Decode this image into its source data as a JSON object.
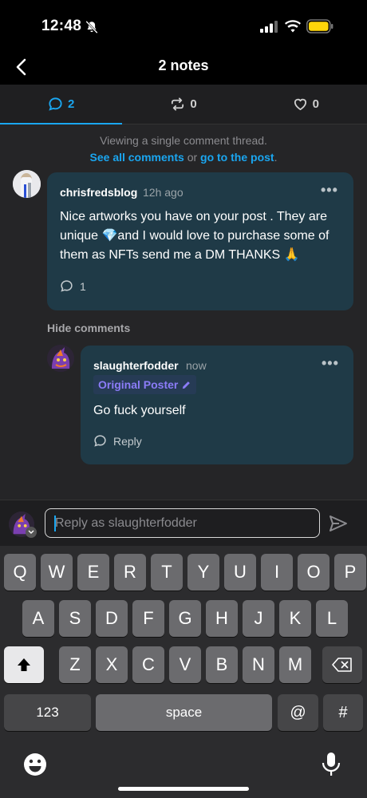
{
  "status_bar": {
    "time": "12:48"
  },
  "header": {
    "title": "2 notes"
  },
  "tabs": [
    {
      "count": "2",
      "icon": "comment-icon",
      "active": true
    },
    {
      "count": "0",
      "icon": "reblog-icon",
      "active": false
    },
    {
      "count": "0",
      "icon": "heart-icon",
      "active": false
    }
  ],
  "thread_note": {
    "line1": "Viewing a single comment thread.",
    "link1": "See all comments",
    "connector": "or",
    "link2": "go to the post",
    "end": "."
  },
  "comment": {
    "username": "chrisfredsblog",
    "time": "12h ago",
    "text": "Nice artworks you have on your post . They are unique 💎and I would love to purchase some of them as NFTs send me a DM THANKS 🙏",
    "reply_count": "1"
  },
  "hide_comments_label": "Hide comments",
  "reply": {
    "username": "slaughterfodder",
    "time": "now",
    "badge": "Original Poster",
    "text": "Go fuck yourself",
    "reply_label": "Reply"
  },
  "composer": {
    "placeholder": "Reply as slaughterfodder"
  },
  "keyboard": {
    "row1": [
      "Q",
      "W",
      "E",
      "R",
      "T",
      "Y",
      "U",
      "I",
      "O",
      "P"
    ],
    "row2": [
      "A",
      "S",
      "D",
      "F",
      "G",
      "H",
      "J",
      "K",
      "L"
    ],
    "row3": [
      "Z",
      "X",
      "C",
      "V",
      "B",
      "N",
      "M"
    ],
    "numbers_label": "123",
    "space_label": "space",
    "at_label": "@",
    "hash_label": "#"
  },
  "colors": {
    "accent": "#1aa6f0",
    "bubble": "#1f3a47",
    "badge_text": "#8b7cf7"
  }
}
